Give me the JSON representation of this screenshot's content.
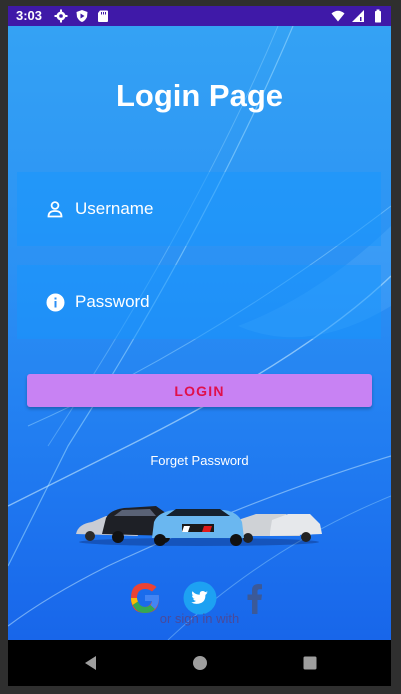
{
  "status_bar": {
    "time": "3:03",
    "left_icons": [
      "gear-icon",
      "play-protect-icon",
      "sd-card-icon"
    ],
    "right_icons": [
      "wifi-icon",
      "signal-icon",
      "battery-icon"
    ]
  },
  "login": {
    "title": "Login Page",
    "username_placeholder": "Username",
    "password_placeholder": "Password",
    "login_label": "LOGIN",
    "forget_password": "Forget Password",
    "or_sign_in_with": "or sign in with"
  },
  "social": [
    "google-icon",
    "twitter-icon",
    "facebook-icon"
  ],
  "colors": {
    "status_bar": "#3f19a8",
    "background_top": "#34a2f4",
    "background_bottom": "#1866ea",
    "login_button": "#c882f3",
    "login_text": "#e0104a"
  },
  "nav_bar": [
    "back-button",
    "home-button",
    "recents-button"
  ]
}
